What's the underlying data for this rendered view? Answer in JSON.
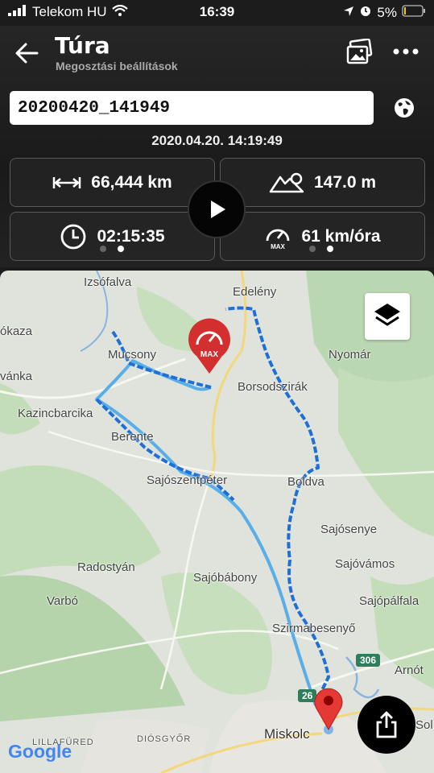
{
  "status": {
    "carrier": "Telekom HU",
    "time": "16:39",
    "battery": "5%"
  },
  "header": {
    "title": "Túra",
    "subtitle": "Megosztási beállítások"
  },
  "track": {
    "name": "20200420_141949",
    "datetime": "2020.04.20.  14:19:49"
  },
  "stats": {
    "distance": "66,444 km",
    "elevation": "147.0 m",
    "duration": "02:15:35",
    "max_speed": "61 km/óra",
    "max_label": "MAX"
  },
  "map": {
    "places": {
      "izsofalva": "Izsófalva",
      "edeleny": "Edelény",
      "okaza": "ókaza",
      "mucsony": "Mucsony",
      "nyomar": "Nyomár",
      "vanka": "vánka",
      "borsodszirak": "Borsodszirák",
      "kazincbarcika": "Kazincbarcika",
      "berente": "Berente",
      "sajoszentpeter": "Sajószentpéter",
      "boldva": "Boldva",
      "sajosenye": "Sajósenye",
      "radostyan": "Radostyán",
      "sajovamos": "Sajóvámos",
      "sajobabony": "Sajóbábony",
      "varbo": "Varbó",
      "sajopalfala": "Sajópálfala",
      "szirmabesenyo": "Szirmabesenyő",
      "arnot": "Arnót",
      "lillafured": "LILLAFÜRED",
      "diosgyor": "DIÓSGYŐR",
      "miskolc": "Miskolc",
      "sol": "Sol"
    },
    "road_badges": {
      "r306": "306",
      "r26": "26"
    },
    "max_marker": "MAX",
    "attribution": "Google",
    "colors": {
      "route_light": "#5aaee8",
      "route_dark": "#1e6fd8",
      "max_pin": "#d32f2f",
      "end_pin": "#e53935"
    }
  }
}
